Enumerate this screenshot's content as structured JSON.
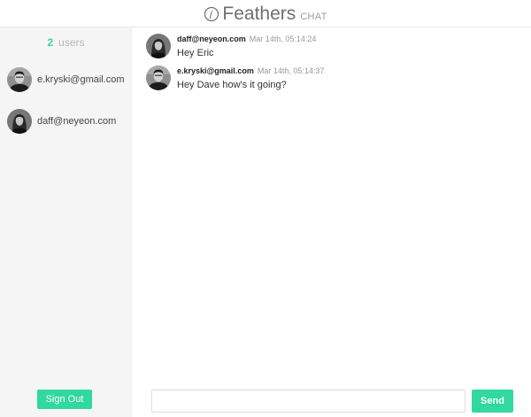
{
  "header": {
    "logo_icon": "feather-circle-icon",
    "title": "Feathers",
    "subtitle": "CHAT"
  },
  "sidebar": {
    "user_count": "2",
    "user_count_label": "users",
    "users": [
      {
        "email": "e.kryski@gmail.com",
        "avatar": "avatar-dark-hair-photo"
      },
      {
        "email": "daff@neyeon.com",
        "avatar": "avatar-long-hair-photo"
      }
    ],
    "signout_label": "Sign Out"
  },
  "chat": {
    "messages": [
      {
        "user": "daff@neyeon.com",
        "time": "Mar 14th, 05:14:24",
        "text": "Hey Eric",
        "avatar": "avatar-long-hair-photo"
      },
      {
        "user": "e.kryski@gmail.com",
        "time": "Mar 14th, 05:14:37",
        "text": "Hey Dave how's it going?",
        "avatar": "avatar-dark-hair-photo"
      }
    ],
    "input_value": "",
    "input_placeholder": "",
    "send_label": "Send"
  },
  "colors": {
    "accent": "#31d8a0",
    "sidebar_bg": "#f5f5f5",
    "header_text": "#6f6f6f"
  }
}
